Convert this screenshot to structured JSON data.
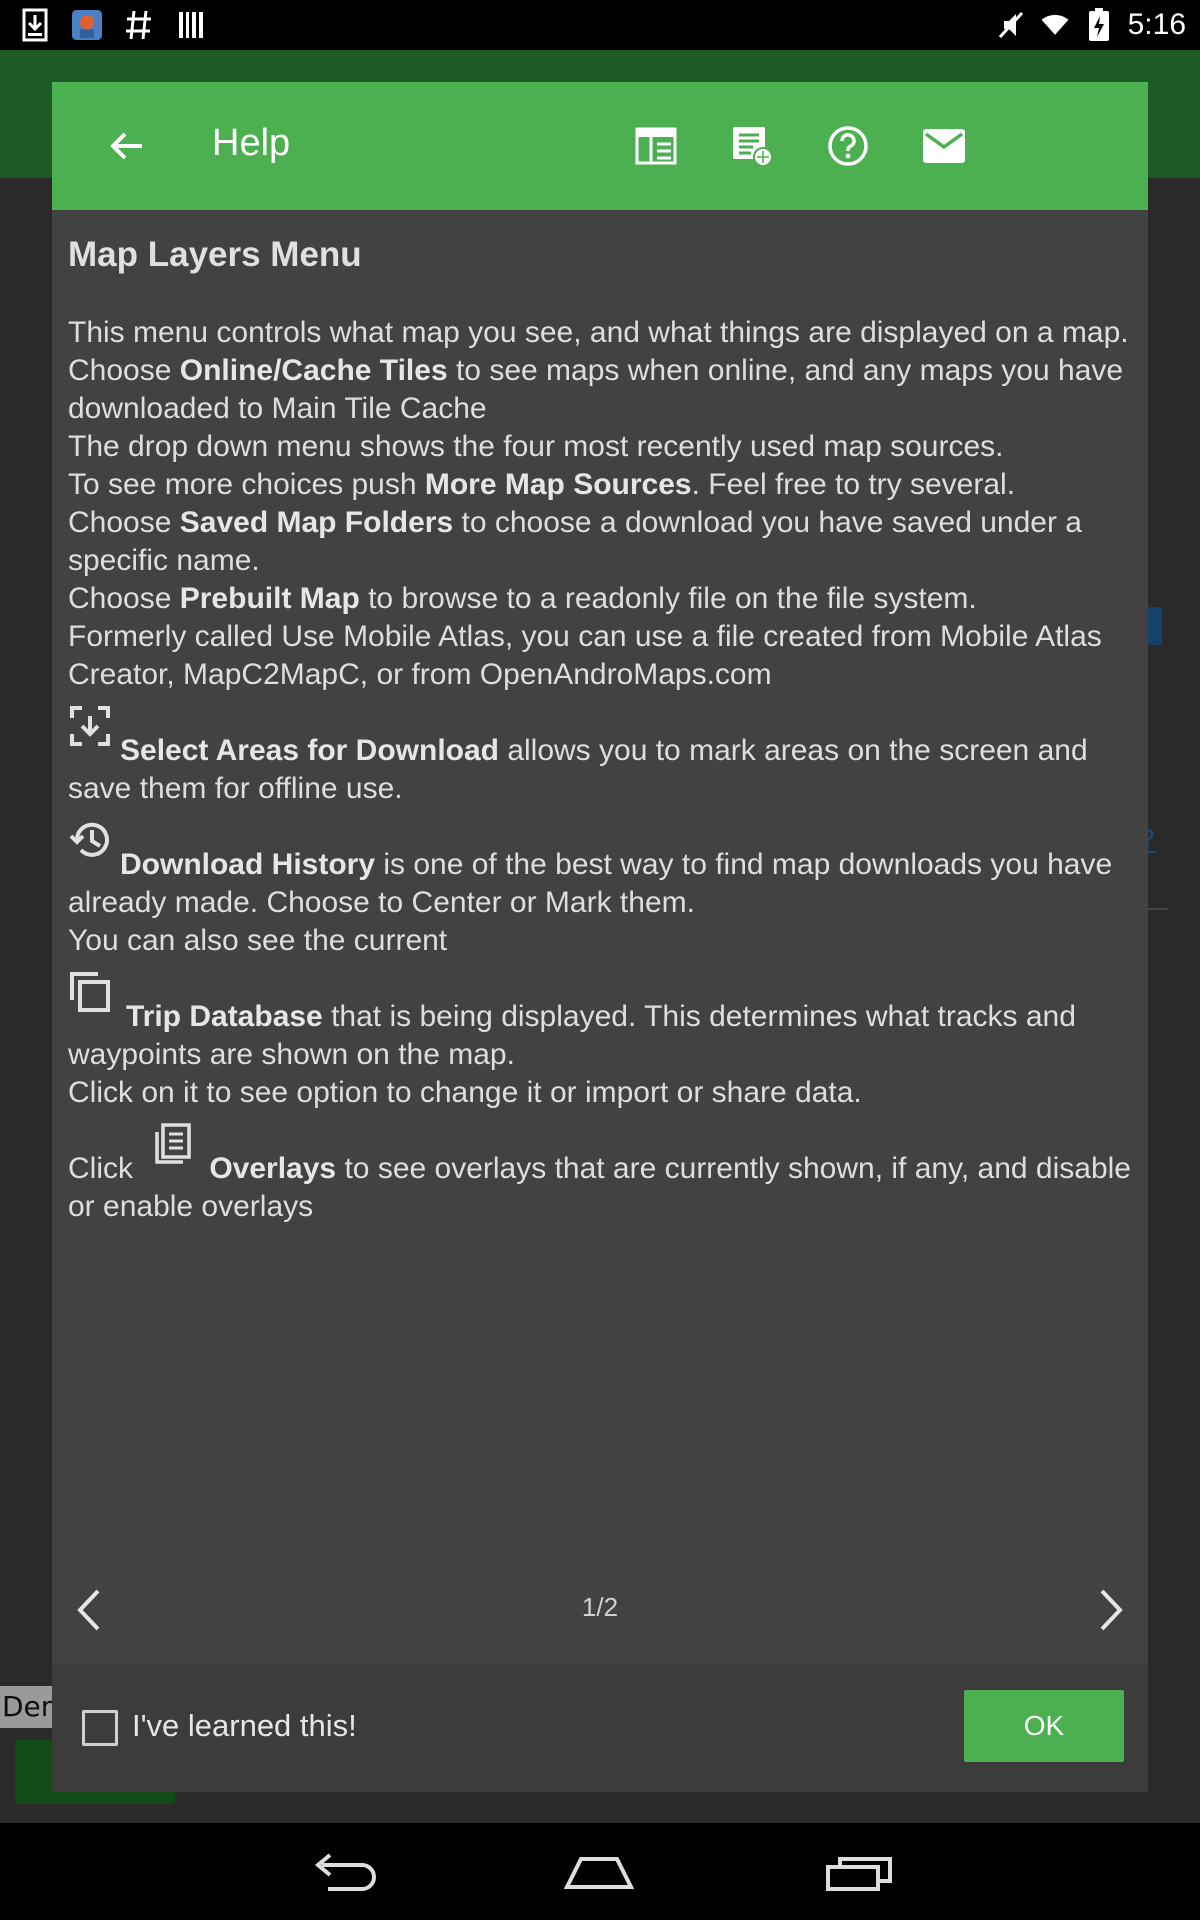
{
  "status_bar": {
    "time": "5:16",
    "left_icons": [
      "download-icon",
      "app-avatar-icon",
      "hashtag-icon",
      "barcode-icon"
    ],
    "right_icons": [
      "mute-icon",
      "wifi-icon",
      "battery-charging-icon"
    ]
  },
  "background": {
    "footer_text": "Dem",
    "side_link": "s?"
  },
  "dialog": {
    "title": "Help",
    "header_icons": [
      "layout-icon",
      "document-globe-icon",
      "help-circle-icon",
      "email-icon"
    ],
    "content": {
      "heading": "Map Layers Menu",
      "para1_intro": "This menu controls what map you see, and what things are displayed on a map.",
      "para1_choose": "Choose ",
      "online_cache_tiles": "Online/Cache Tiles",
      "para1_online_rest": " to see maps when online, and any maps you have downloaded to Main Tile Cache",
      "para1_dropdown": "The drop down menu shows the four most recently used map sources.",
      "para1_more_pre": "To see more choices push ",
      "more_map_sources": "More Map Sources",
      "para1_more_post": ". Feel free to try several.",
      "para1_choose2": "Choose ",
      "saved_map_folders": "Saved Map Folders",
      "para1_saved_rest": " to choose a download you have saved under a specific name.",
      "para1_choose3": "Choose ",
      "prebuilt_map": "Prebuilt Map",
      "para1_prebuilt_rest": " to browse to a readonly file on the file system.",
      "para1_formerly": "Formerly called Use Mobile Atlas, you can use a file created from Mobile Atlas Creator, MapC2MapC, or from OpenAndroMaps.com",
      "select_areas": "Select Areas for Download",
      "select_areas_rest": " allows you to mark areas on the screen and save them for offline use.",
      "download_history": "Download History",
      "download_history_rest": " is one of the best way to find map downloads you have already made. Choose to Center or Mark them.",
      "download_history_also": "You can also see the current",
      "trip_database": "Trip Database",
      "trip_database_rest": " that is being displayed. This determines what tracks and waypoints are shown on the map.",
      "trip_database_click": "Click on it to see option to change it or import or share data.",
      "overlays_click": "Click ",
      "overlays": "Overlays",
      "overlays_rest": " to see overlays that are currently shown, if any, and disable or enable overlays"
    },
    "pager": {
      "current": "1/2"
    },
    "footer": {
      "checkbox_label": "I've learned this!",
      "checkbox_checked": false,
      "ok_label": "OK"
    }
  },
  "navbar": {
    "buttons": [
      "back-nav-icon",
      "home-nav-icon",
      "recents-nav-icon"
    ]
  },
  "colors": {
    "accent_green": "#4caf50",
    "dialog_bg": "#424242"
  }
}
